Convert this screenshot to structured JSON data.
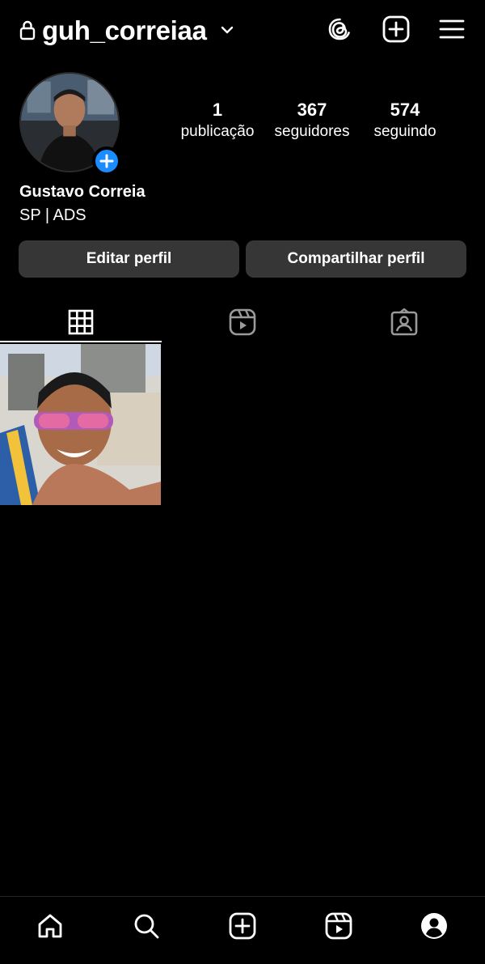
{
  "header": {
    "username": "guh_correiaa",
    "icons": [
      "lock-icon",
      "chevron-down-icon",
      "threads-icon",
      "create-post-icon",
      "menu-icon"
    ]
  },
  "profile": {
    "display_name": "Gustavo Correia",
    "bio": "SP | ADS",
    "stats": [
      {
        "value": "1",
        "label": "publicação"
      },
      {
        "value": "367",
        "label": "seguidores"
      },
      {
        "value": "574",
        "label": "seguindo"
      }
    ]
  },
  "actions": {
    "edit_label": "Editar perfil",
    "share_label": "Compartilhar perfil"
  },
  "tabs": [
    {
      "icon": "grid-icon",
      "active": true
    },
    {
      "icon": "reels-icon",
      "active": false
    },
    {
      "icon": "tagged-icon",
      "active": false
    }
  ],
  "bottom_nav": [
    "home-icon",
    "search-icon",
    "create-icon",
    "reels-icon",
    "profile-icon"
  ],
  "colors": {
    "background": "#000000",
    "button": "#363636",
    "accent": "#1a8cff"
  }
}
